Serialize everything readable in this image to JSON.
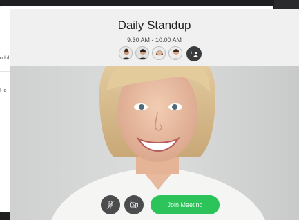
{
  "background_app": {
    "snippets": [
      "odul",
      "I lo"
    ]
  },
  "meeting": {
    "title": "Daily Standup",
    "time": "9:30 AM - 10:00 AM",
    "participants": [
      {
        "icon": "participant-avatar-1"
      },
      {
        "icon": "participant-avatar-2"
      },
      {
        "icon": "participant-avatar-3"
      },
      {
        "icon": "participant-avatar-4"
      }
    ],
    "extra_count": "1"
  },
  "controls": {
    "mic_icon": "mic-muted-icon",
    "camera_icon": "camera-off-icon",
    "join_label": "Join Meeting"
  },
  "colors": {
    "join": "#2cc45a",
    "control": "#4b4c4e",
    "header": "#f0f0f0"
  }
}
